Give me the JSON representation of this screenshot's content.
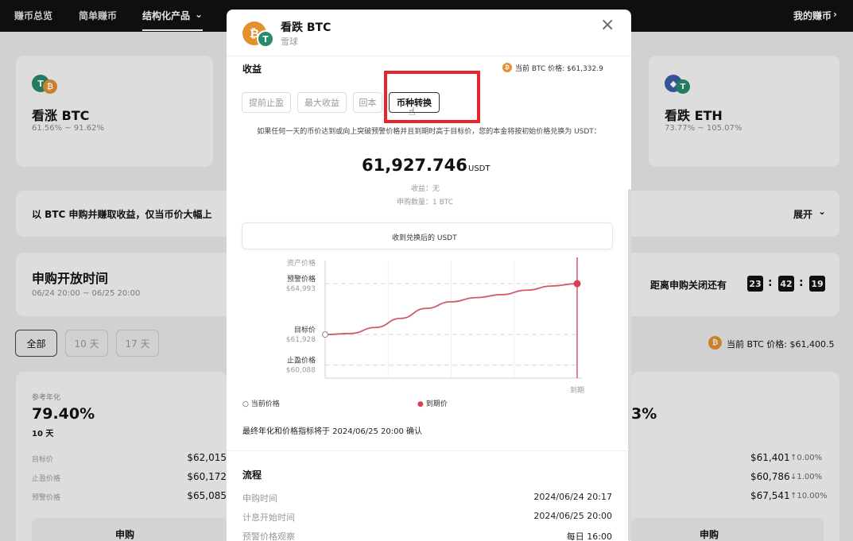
{
  "topnav": {
    "items": [
      "赚币总览",
      "简单赚币",
      "结构化产品"
    ],
    "right_link": "我的赚币"
  },
  "left_card": {
    "title": "看涨 BTC",
    "range": "61.56% ~ 91.62%"
  },
  "right_card": {
    "title": "看跌 ETH",
    "range": "73.77% ~ 105.07%"
  },
  "banner": {
    "text": "以 BTC 申购并赚取收益，仅当币价大幅上",
    "expand": "展开"
  },
  "subscribe": {
    "title": "申购开放时间",
    "dates": "06/24 20:00 ~ 06/25 20:00",
    "countdown_label": "距离申购关闭还有",
    "hours": "23",
    "minutes": "42",
    "seconds": "19"
  },
  "filters": [
    "全部",
    "10 天",
    "17 天"
  ],
  "current_btc_price_bg": "当前 BTC 价格: $61,400.5",
  "left_product": {
    "ref_label": "参考年化",
    "apy": "79.40%",
    "days": "10 天",
    "rows": [
      {
        "label": "目标价",
        "value": "$62,015"
      },
      {
        "label": "止盈价格",
        "value": "$60,172"
      },
      {
        "label": "预警价格",
        "value": "$65,085"
      }
    ],
    "button": "申购"
  },
  "right_product": {
    "apy_partial": "3%",
    "rows": [
      {
        "value": "$61,401",
        "change": "↑0.00%"
      },
      {
        "value": "$60,786",
        "change": "↓1.00%"
      },
      {
        "value": "$67,541",
        "change": "↑10.00%"
      }
    ],
    "button": "申购"
  },
  "modal": {
    "title": "看跌 BTC",
    "subtitle": "雪球",
    "close": "×",
    "section_label": "收益",
    "current_price": "当前 BTC 价格: $61,332.9",
    "tabs": [
      "提前止盈",
      "最大收益",
      "回本",
      "币种转换"
    ],
    "description": "如果任何一天的币价达到或向上突破预警价格并且到期时高于目标价，您的本金将按初始价格兑换为 USDT：",
    "amount": "61,927.746",
    "amount_unit": "USDT",
    "earnings": "收益：无",
    "sub_qty": "申购数量：1 BTC",
    "tooltip": "收到兑换后的 USDT",
    "chart_legend_current": "当前价格",
    "chart_legend_expiry": "到期价",
    "confirm_note": "最终年化和价格指标将于 2024/06/25 20:00 确认",
    "flow_title": "流程",
    "flow": [
      {
        "label": "申购时间",
        "value": "2024/06/24 20:17"
      },
      {
        "label": "计息开始时间",
        "value": "2024/06/25 20:00"
      },
      {
        "label": "预警价格观察",
        "value": "每日 16:00"
      }
    ]
  },
  "chart_data": {
    "type": "line",
    "ylabel": "资产价格",
    "xlabel": "到期",
    "y_ticks": [
      {
        "label": "预警价格",
        "value": 64993,
        "display": "$64,993"
      },
      {
        "label": "目标价",
        "value": 61928,
        "display": "$61,928"
      },
      {
        "label": "止盈价格",
        "value": 60088,
        "display": "$60,088"
      }
    ],
    "series": [
      {
        "values": [
          61928,
          61990,
          62350,
          62900,
          63500,
          63900,
          64150,
          64330,
          64600,
          64850,
          64993
        ]
      }
    ],
    "ylim": [
      59300,
      66000
    ],
    "colors": {
      "line": "#d05a6a",
      "marker": "#d8404f",
      "grid": "#d8d8d8"
    }
  }
}
